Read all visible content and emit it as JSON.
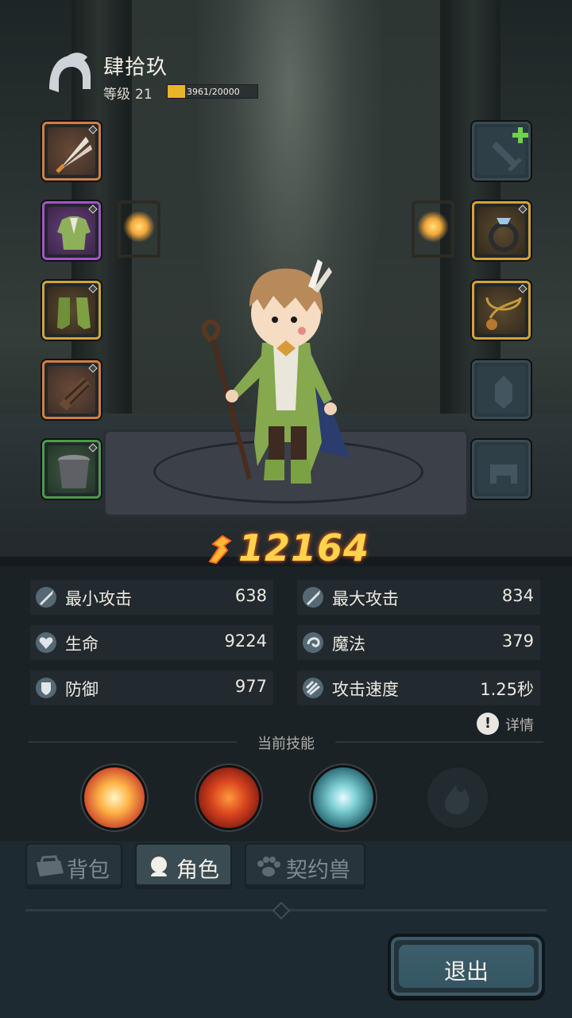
{
  "player": {
    "name": "肆拾玖",
    "level_label": "等级",
    "level": "21",
    "xp_text": "3961/20000",
    "xp_current": 3961,
    "xp_max": 20000
  },
  "power": {
    "value": "12164"
  },
  "stats": {
    "min_attack": {
      "label": "最小攻击",
      "value": "638"
    },
    "max_attack": {
      "label": "最大攻击",
      "value": "834"
    },
    "hp": {
      "label": "生命",
      "value": "9224"
    },
    "magic": {
      "label": "魔法",
      "value": "379"
    },
    "defense": {
      "label": "防御",
      "value": "977"
    },
    "attack_speed": {
      "label": "攻击速度",
      "value": "1.25秒"
    }
  },
  "details": {
    "label": "详情"
  },
  "skills": {
    "title": "当前技能"
  },
  "tabs": [
    {
      "label": "背包"
    },
    {
      "label": "角色"
    },
    {
      "label": "契约兽"
    }
  ],
  "exit": {
    "label": "退出"
  },
  "colors": {
    "power": "#ffd34d",
    "xp_fill": "#e8b52a",
    "slot_orange": "#d87c3c",
    "slot_purple": "#a652c9",
    "slot_gold": "#d3a23a",
    "slot_green": "#4f9a4b"
  }
}
